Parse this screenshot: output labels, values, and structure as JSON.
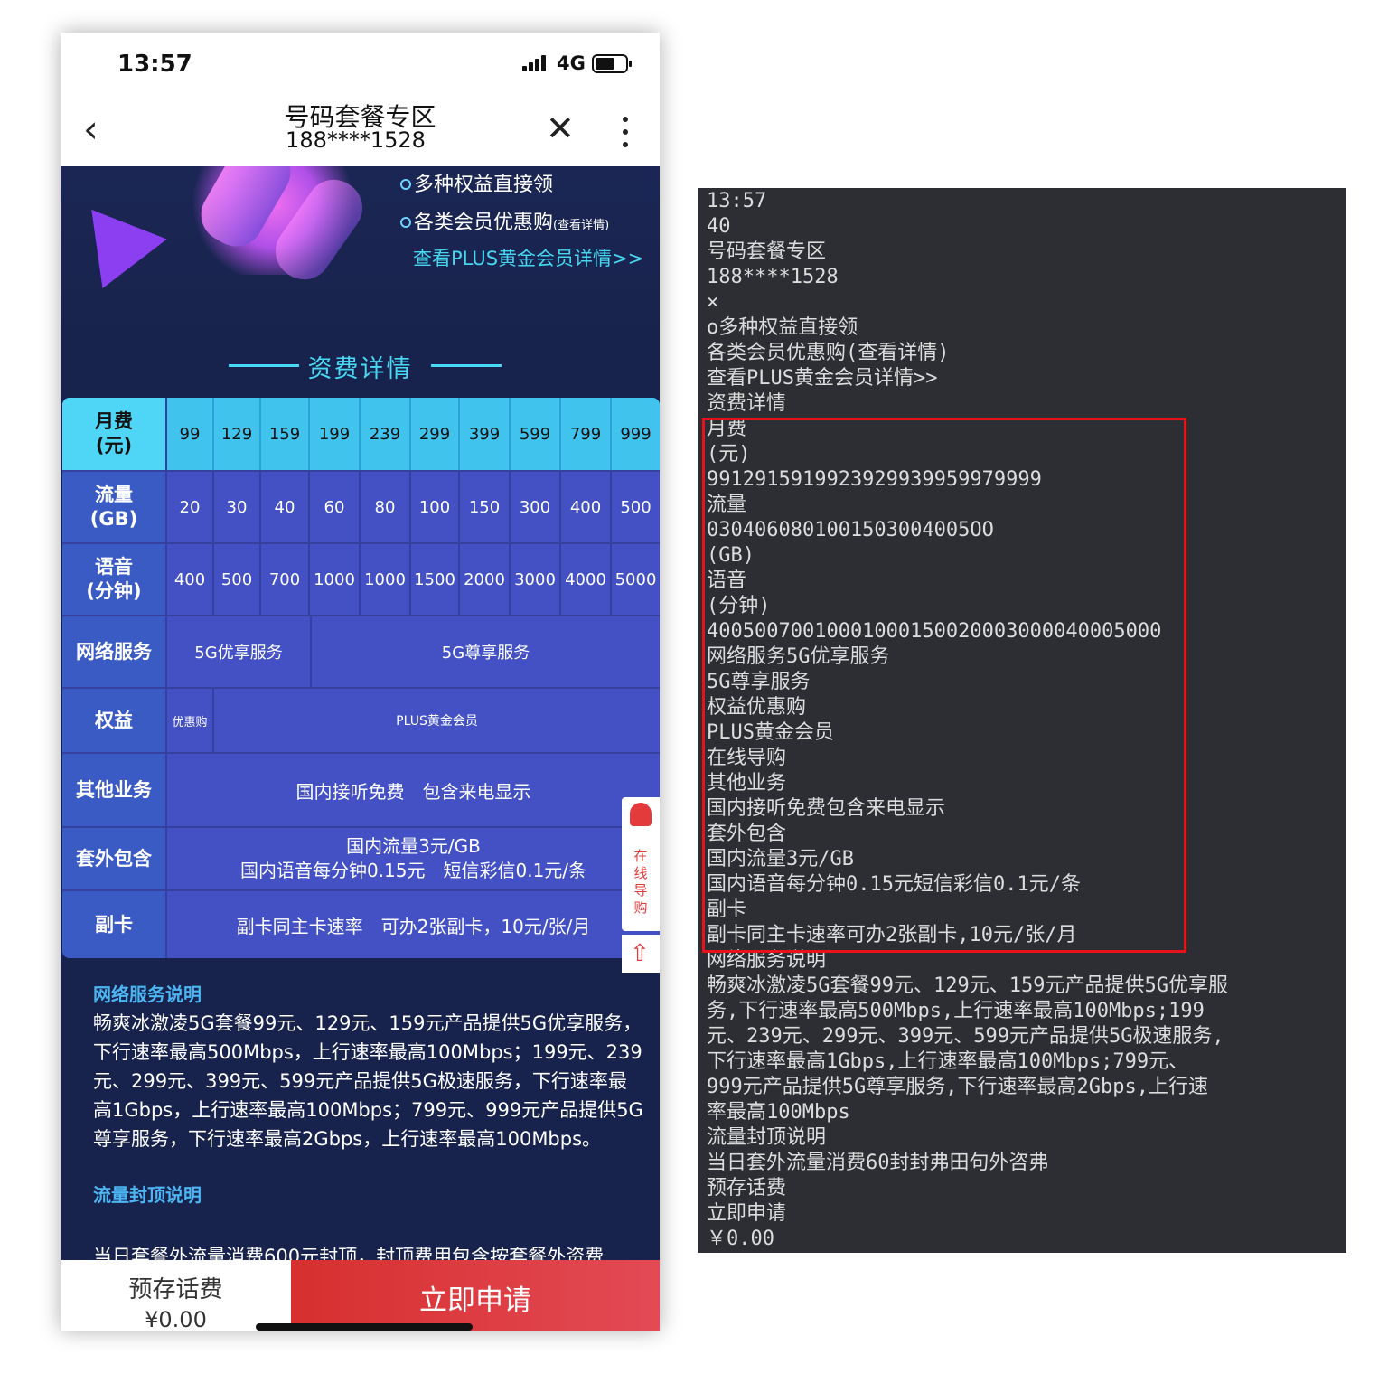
{
  "status": {
    "time": "13:57",
    "network": "4G"
  },
  "nav": {
    "title": "号码套餐专区",
    "subtitle": "188****1528"
  },
  "promo": {
    "bullet1": "多种权益直接领",
    "bullet2": "各类会员优惠购",
    "bullet2_small": "(查看详情)",
    "plus_link": "查看PLUS黄金会员详情>>"
  },
  "section_title": "资费详情",
  "table": {
    "rows": [
      {
        "label": "月费\n(元)",
        "cells": [
          "99",
          "129",
          "159",
          "199",
          "239",
          "299",
          "399",
          "599",
          "799",
          "999"
        ]
      },
      {
        "label": "流量\n(GB)",
        "cells": [
          "20",
          "30",
          "40",
          "60",
          "80",
          "100",
          "150",
          "300",
          "400",
          "500"
        ]
      },
      {
        "label": "语音\n(分钟)",
        "cells": [
          "400",
          "500",
          "700",
          "1000",
          "1000",
          "1500",
          "2000",
          "3000",
          "4000",
          "5000"
        ]
      },
      {
        "label": "网络服务",
        "cells": [
          "5G优享服务",
          "5G尊享服务"
        ]
      },
      {
        "label": "权益",
        "cells": [
          "优惠购",
          "PLUS黄金会员"
        ]
      },
      {
        "label": "其他业务",
        "cells": [
          "国内接听免费　包含来电显示"
        ]
      },
      {
        "label": "套外包含",
        "cells": [
          "国内流量3元/GB\n国内语音每分钟0.15元　短信彩信0.1元/条"
        ]
      },
      {
        "label": "副卡",
        "cells": [
          "副卡同主卡速率　可办2张副卡，10元/张/月"
        ]
      }
    ]
  },
  "float_widget": {
    "label": "在线导购"
  },
  "description": {
    "network_title": "网络服务说明",
    "network_text": "畅爽冰激凌5G套餐99元、129元、159元产品提供5G优享服务，下行速率最高500Mbps，上行速率最高100Mbps；199元、239元、299元、399元、599元产品提供5G极速服务，下行速率最高1Gbps，上行速率最高100Mbps；799元、999元产品提供5G尊享服务，下行速率最高2Gbps，上行速率最高100Mbps。",
    "cap_title": "流量封顶说明",
    "cap_text": "当日套餐外流量消费600元封顶，封顶费用包含按套餐外资费"
  },
  "bottom": {
    "deposit_label": "预存话费",
    "deposit_amount": "¥0.00",
    "apply_label": "立即申请"
  },
  "ocr_lines": [
    "13:57",
    "40",
    "号码套餐专区",
    "188****1528",
    "×",
    "o多种权益直接领",
    "各类会员优惠购(查看详情)",
    "查看PLUS黄金会员详情>>",
    "资费详情",
    "月费",
    "(元)",
    "9912915919923929939959979999",
    "流量",
    "0304060801001503004005OO",
    " (GB)",
    "语音",
    "(分钟)",
    "40050070010001000150020003000040005000",
    "网络服务5G优享服务",
    "5G尊享服务",
    "权益优惠购",
    "PLUS黄金会员",
    "在线导购",
    "其他业务",
    "国内接听免费包含来电显示",
    "套外包含",
    "国内流量3元/GB",
    "国内语音每分钟0.15元短信彩信0.1元/条",
    "副卡",
    "副卡同主卡速率可办2张副卡,10元/张/月",
    "网络服务说明",
    "畅爽冰激凌5G套餐99元、129元、159元产品提供5G优享服",
    "务,下行速率最高500Mbps,上行速率最高100Mbps;199",
    "元、239元、299元、399元、599元产品提供5G极速服务,",
    "下行速率最高1Gbps,上行速率最高100Mbps;799元、",
    "999元产品提供5G尊享服务,下行速率最高2Gbps,上行速",
    "率最高100Mbps",
    "流量封顶说明",
    "当日套外流量消费60封封弗田句外咨弗",
    "预存话费",
    "立即申请",
    "￥0.00"
  ]
}
